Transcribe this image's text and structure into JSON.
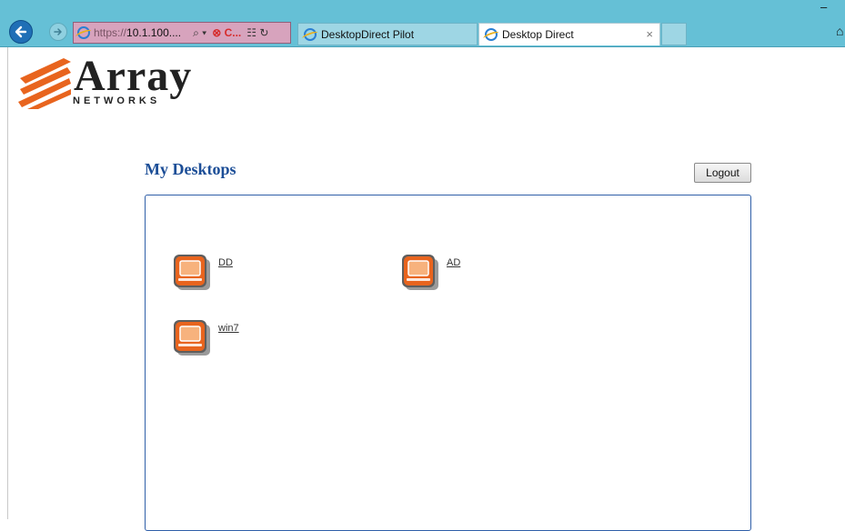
{
  "browser": {
    "address": {
      "scheme": "https://",
      "host": "10.1.100....",
      "search_symbol": "⌕ ▾",
      "stop_symbol": "⊗ C...",
      "extra_symbols": "☷ ↻"
    },
    "tabs": [
      {
        "label": "DesktopDirect Pilot",
        "active": false
      },
      {
        "label": "Desktop Direct",
        "active": true,
        "close": "×"
      }
    ],
    "minimize_symbol": "–",
    "home_symbol": "⌂"
  },
  "logo": {
    "word": "Array",
    "sub": "NETWORKS"
  },
  "page": {
    "title": "My Desktops",
    "logout_label": "Logout"
  },
  "desktops": [
    {
      "label": "DD"
    },
    {
      "label": "AD"
    },
    {
      "label": "win7"
    }
  ],
  "colors": {
    "chrome": "#65c0d6",
    "title": "#1c4e97",
    "panel_border": "#2f5fa8",
    "logo_orange": "#e8641e"
  }
}
